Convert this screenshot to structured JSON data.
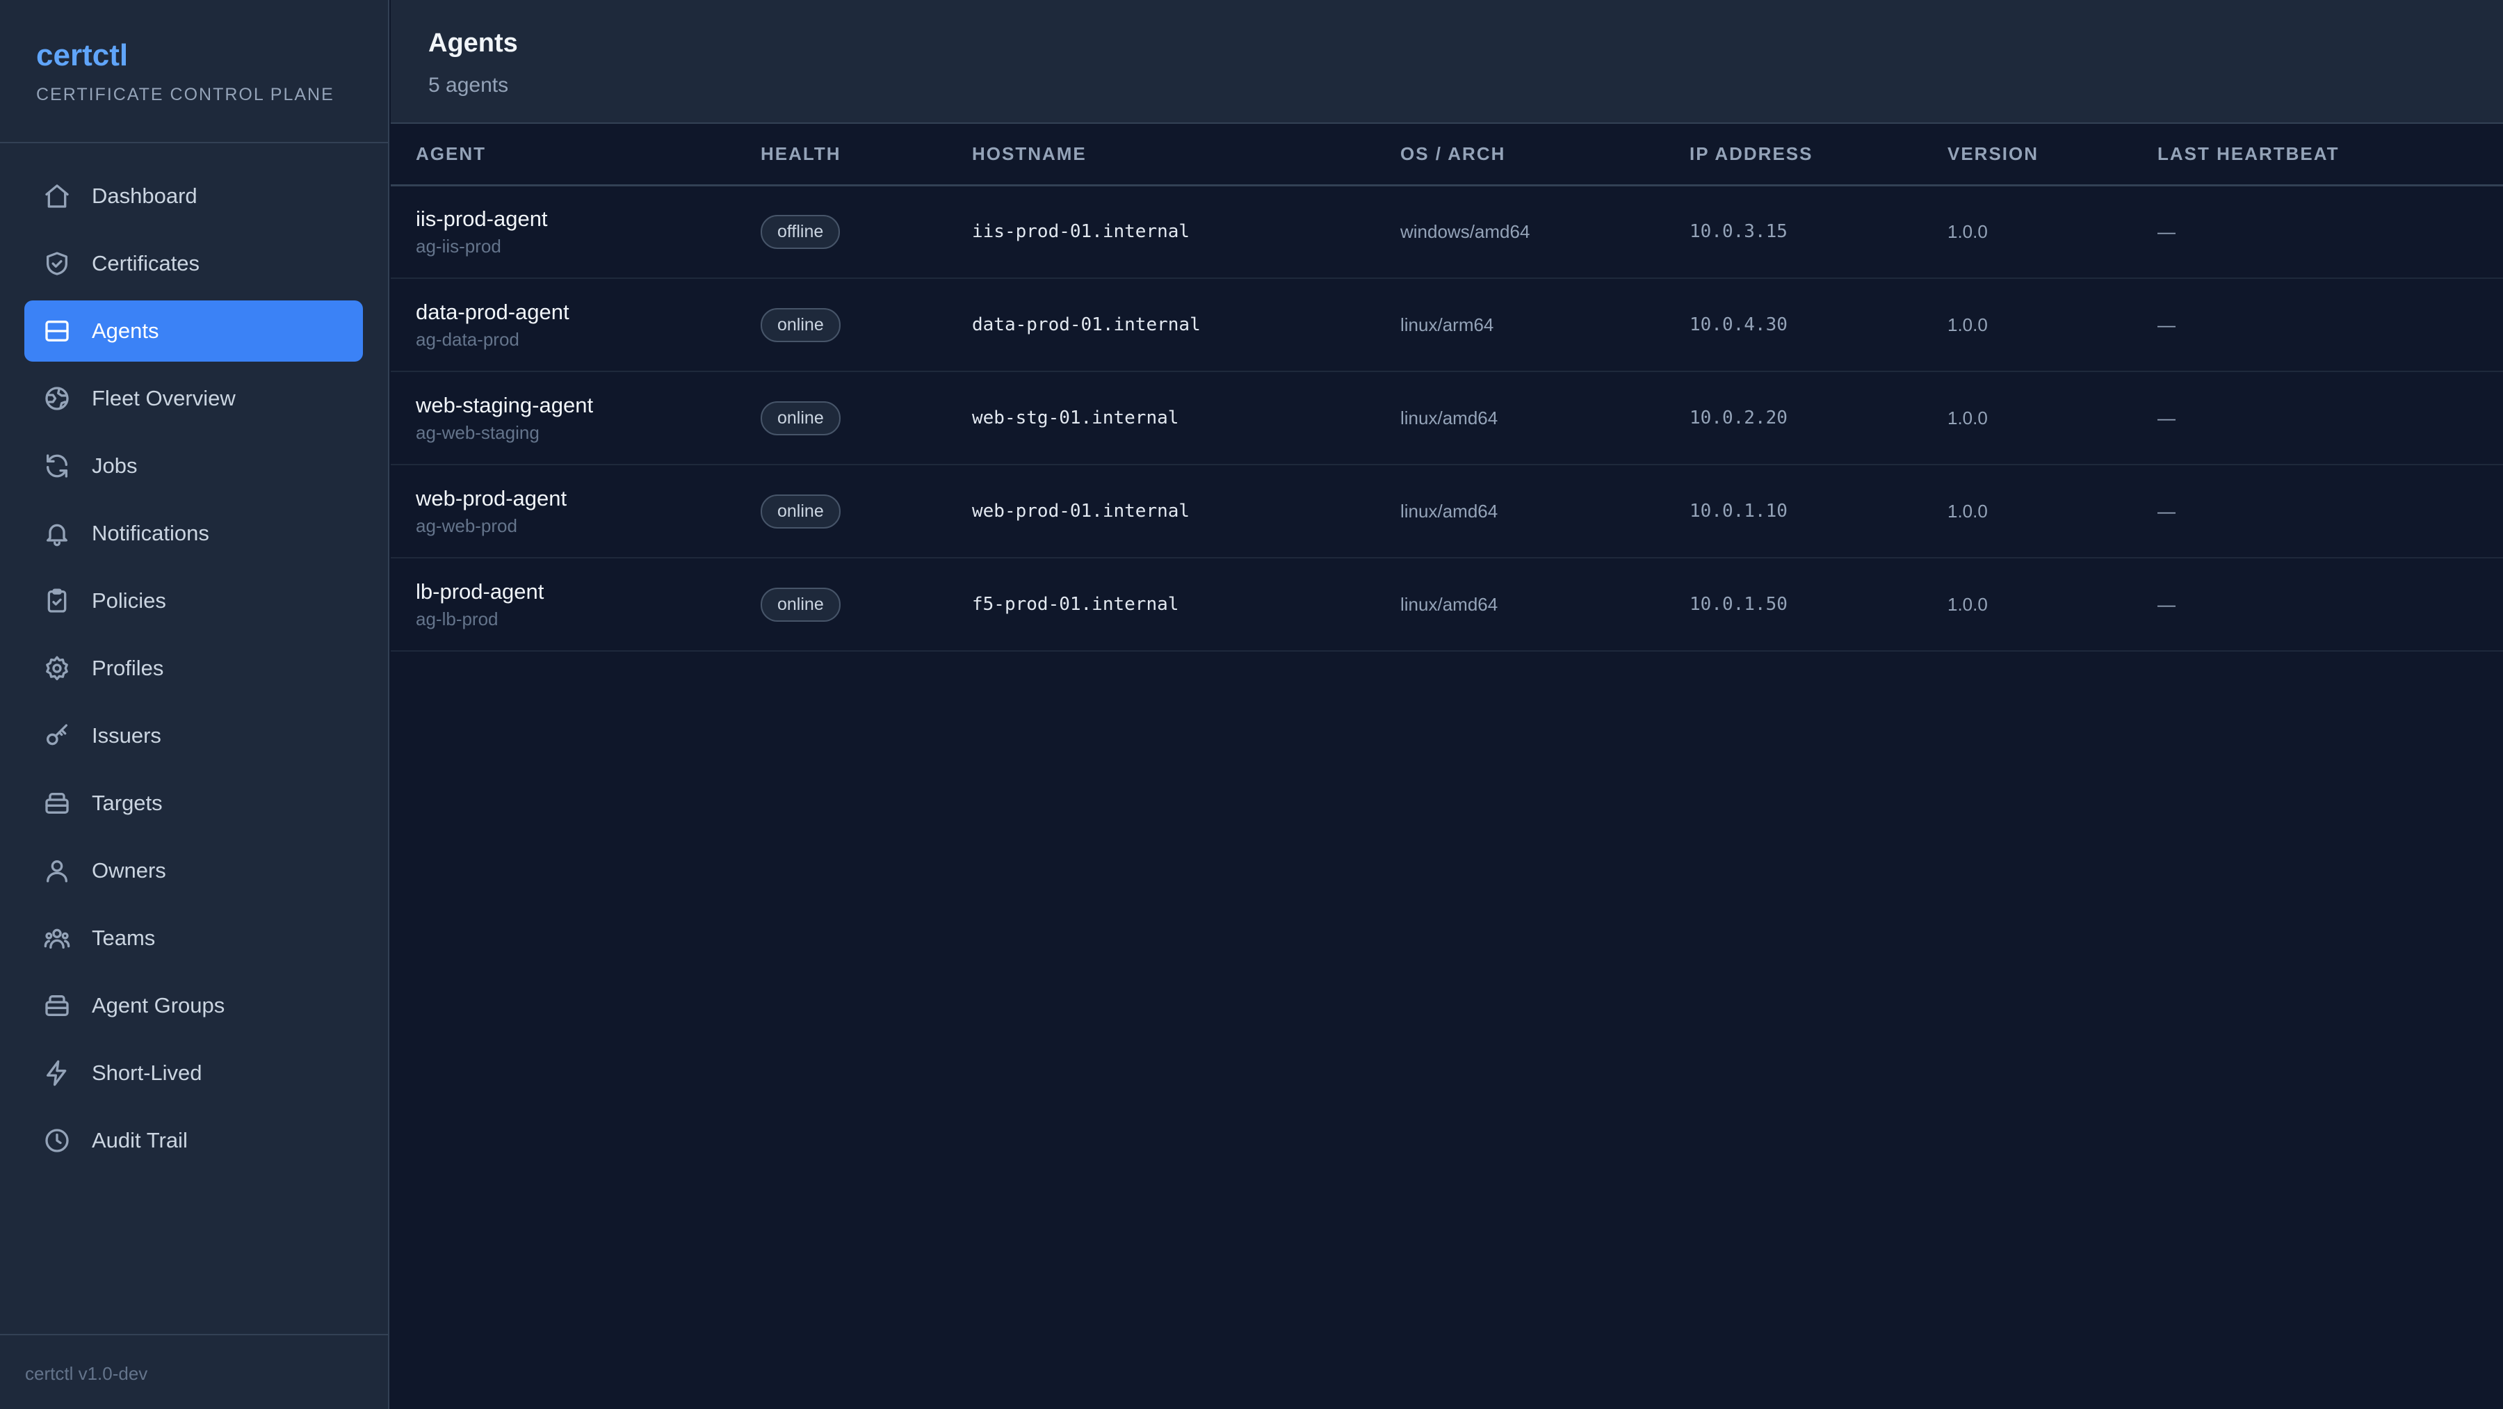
{
  "brand": {
    "name": "certctl",
    "subtitle": "CERTIFICATE CONTROL PLANE"
  },
  "sidebar": {
    "items": [
      {
        "label": "Dashboard",
        "icon": "home-icon"
      },
      {
        "label": "Certificates",
        "icon": "shield-icon"
      },
      {
        "label": "Agents",
        "icon": "server-icon",
        "active": true
      },
      {
        "label": "Fleet Overview",
        "icon": "globe-icon"
      },
      {
        "label": "Jobs",
        "icon": "refresh-icon"
      },
      {
        "label": "Notifications",
        "icon": "bell-icon"
      },
      {
        "label": "Policies",
        "icon": "clipboard-check-icon"
      },
      {
        "label": "Profiles",
        "icon": "gear-icon"
      },
      {
        "label": "Issuers",
        "icon": "key-icon"
      },
      {
        "label": "Targets",
        "icon": "stack-icon"
      },
      {
        "label": "Owners",
        "icon": "user-icon"
      },
      {
        "label": "Teams",
        "icon": "users-icon"
      },
      {
        "label": "Agent Groups",
        "icon": "stack-icon"
      },
      {
        "label": "Short-Lived",
        "icon": "bolt-icon"
      },
      {
        "label": "Audit Trail",
        "icon": "clock-icon"
      }
    ],
    "footer": "certctl v1.0-dev"
  },
  "header": {
    "title": "Agents",
    "subtitle": "5 agents"
  },
  "table": {
    "columns": [
      "AGENT",
      "HEALTH",
      "HOSTNAME",
      "OS / ARCH",
      "IP ADDRESS",
      "VERSION",
      "LAST HEARTBEAT"
    ],
    "rows": [
      {
        "name": "iis-prod-agent",
        "id": "ag-iis-prod",
        "health": "offline",
        "hostname": "iis-prod-01.internal",
        "os": "windows/amd64",
        "ip": "10.0.3.15",
        "version": "1.0.0",
        "heartbeat": "—"
      },
      {
        "name": "data-prod-agent",
        "id": "ag-data-prod",
        "health": "online",
        "hostname": "data-prod-01.internal",
        "os": "linux/arm64",
        "ip": "10.0.4.30",
        "version": "1.0.0",
        "heartbeat": "—"
      },
      {
        "name": "web-staging-agent",
        "id": "ag-web-staging",
        "health": "online",
        "hostname": "web-stg-01.internal",
        "os": "linux/amd64",
        "ip": "10.0.2.20",
        "version": "1.0.0",
        "heartbeat": "—"
      },
      {
        "name": "web-prod-agent",
        "id": "ag-web-prod",
        "health": "online",
        "hostname": "web-prod-01.internal",
        "os": "linux/amd64",
        "ip": "10.0.1.10",
        "version": "1.0.0",
        "heartbeat": "—"
      },
      {
        "name": "lb-prod-agent",
        "id": "ag-lb-prod",
        "health": "online",
        "hostname": "f5-prod-01.internal",
        "os": "linux/amd64",
        "ip": "10.0.1.50",
        "version": "1.0.0",
        "heartbeat": "—"
      }
    ]
  },
  "colors": {
    "accent": "#3b82f6",
    "brand": "#60a5fa",
    "sidebar_bg": "#1e293b",
    "main_bg": "#0f172a"
  }
}
